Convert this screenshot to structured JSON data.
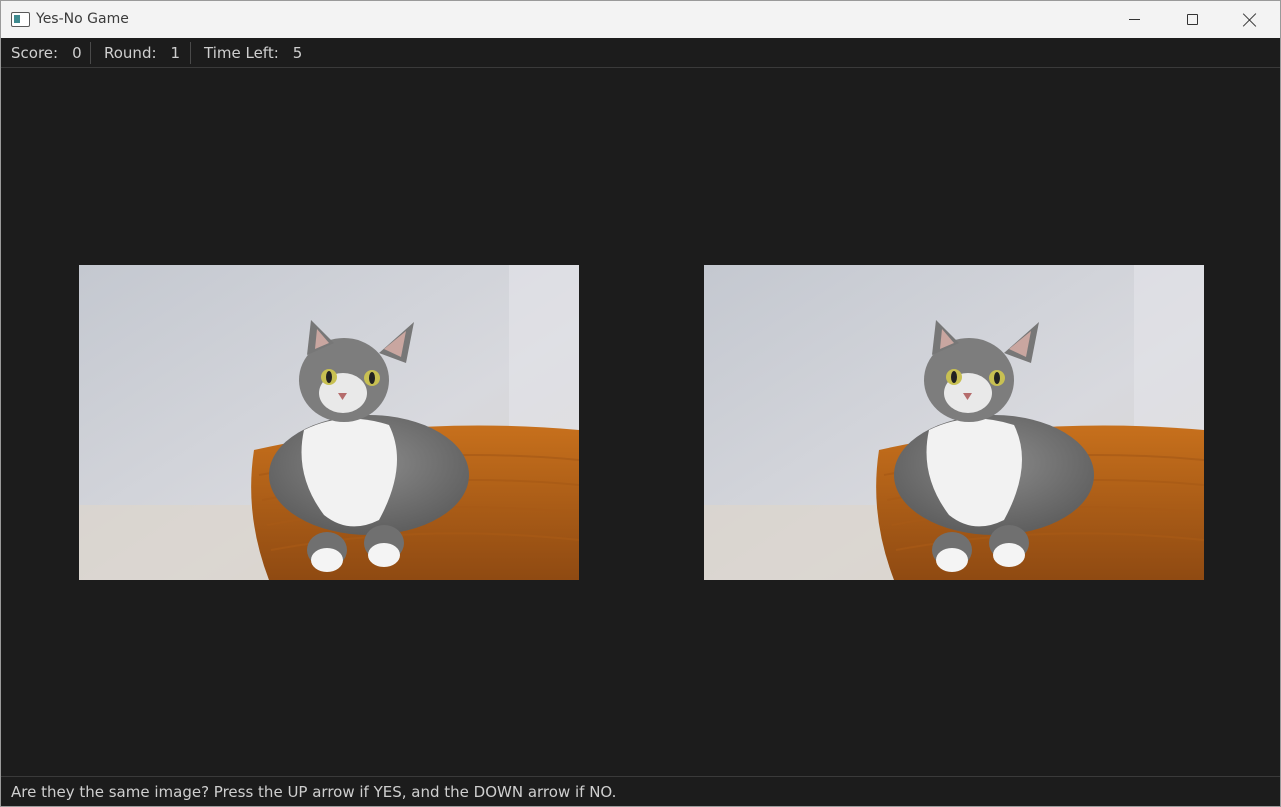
{
  "window": {
    "title": "Yes-No Game"
  },
  "status": {
    "score_label": "Score:",
    "score_value": "0",
    "round_label": "Round:",
    "round_value": "1",
    "time_label": "Time Left:",
    "time_value": "5"
  },
  "images": {
    "left": {
      "subject": "cat-in-basket-photo"
    },
    "right": {
      "subject": "cat-in-basket-photo"
    }
  },
  "instructions": "Are they the same image? Press the UP arrow if YES, and the DOWN arrow if NO.",
  "colors": {
    "background": "#1c1c1c",
    "titlebar": "#f3f3f3",
    "text": "#cfcfcf"
  }
}
